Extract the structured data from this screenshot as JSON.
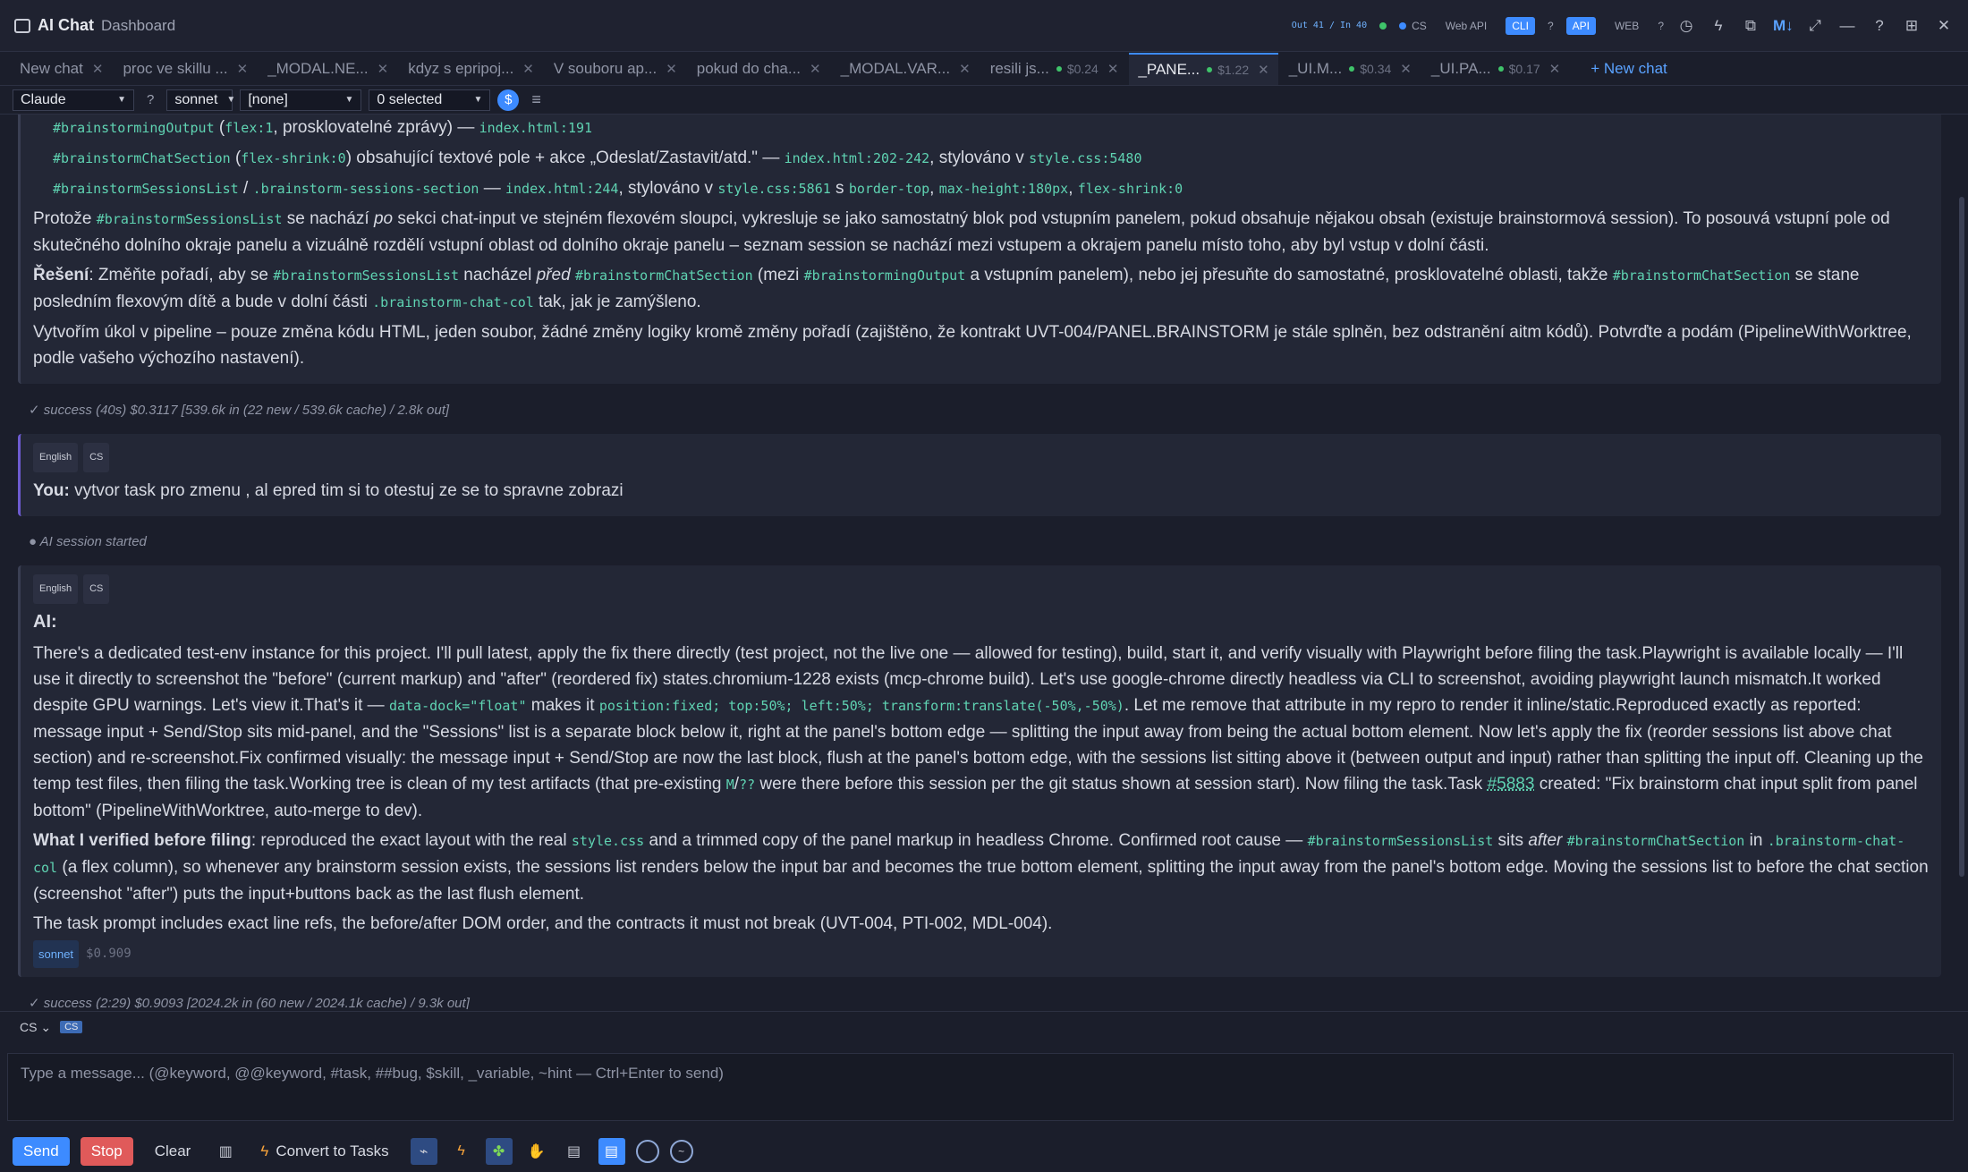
{
  "app": {
    "title": "AI Chat",
    "subtitle": "Dashboard"
  },
  "titlebar": {
    "stats": "Out 41 / In 40",
    "cs_label": "CS",
    "webapi_label": "Web API",
    "cli_label": "CLI",
    "api_label": "API",
    "web_label": "WEB",
    "help": "?",
    "icons": [
      "clock-icon",
      "bolt-icon",
      "copy-icon",
      "markdown-icon",
      "expand-icon",
      "minimize-icon",
      "help-icon",
      "layout-icon",
      "close-icon"
    ],
    "markdown_label": "M↓"
  },
  "tabs": [
    {
      "label": "New chat",
      "cost": "",
      "dot": false,
      "active": false
    },
    {
      "label": "proc ve skillu ...",
      "cost": "",
      "dot": false,
      "active": false
    },
    {
      "label": "_MODAL.NE...",
      "cost": "",
      "dot": false,
      "active": false
    },
    {
      "label": "kdyz s epripoj...",
      "cost": "",
      "dot": false,
      "active": false
    },
    {
      "label": "V souboru ap...",
      "cost": "",
      "dot": false,
      "active": false
    },
    {
      "label": "pokud do cha...",
      "cost": "",
      "dot": false,
      "active": false
    },
    {
      "label": "_MODAL.VAR...",
      "cost": "",
      "dot": false,
      "active": false
    },
    {
      "label": "resili js...",
      "cost": "$0.24",
      "dot": true,
      "active": false
    },
    {
      "label": "_PANE...",
      "cost": "$1.22",
      "dot": true,
      "active": true
    },
    {
      "label": "_UI.M...",
      "cost": "$0.34",
      "dot": true,
      "active": false
    },
    {
      "label": "_UI.PA...",
      "cost": "$0.17",
      "dot": true,
      "active": false
    }
  ],
  "new_chat_label": "+ New chat",
  "toolbar": {
    "provider": "Claude",
    "help": "?",
    "model": "sonnet",
    "preset": "[none]",
    "selection": "0 selected",
    "dollar": "$",
    "menu": "≡"
  },
  "messages": {
    "m1": {
      "b1_code1": "#brainstormingOutput",
      "b1_t1": " (",
      "b1_code2": "flex:1",
      "b1_t2": ", prosklovatelné zprávy) — ",
      "b1_code3": "index.html:191",
      "b2_code1": "#brainstormChatSection",
      "b2_t1": " (",
      "b2_code2": "flex-shrink:0",
      "b2_t2": ") obsahující textové pole + akce „Odeslat/Zastavit/atd.\" — ",
      "b2_code3": "index.html:202-242",
      "b2_t3": ", stylováno v ",
      "b2_code4": "style.css:5480",
      "b3_code1": "#brainstormSessionsList",
      "b3_t1": " / ",
      "b3_code2": ".brainstorm-sessions-section",
      "b3_t2": " — ",
      "b3_code3": "index.html:244",
      "b3_t3": ", stylováno v ",
      "b3_code4": "style.css:5861",
      "b3_t4": " s ",
      "b3_code5": "border-top",
      "b3_t5": ", ",
      "b3_code6": "max-height:180px",
      "b3_t6": ", ",
      "b3_code7": "flex-shrink:0",
      "p1_t1": "Protože ",
      "p1_code1": "#brainstormSessionsList",
      "p1_t2": " se nachází ",
      "p1_em": "po",
      "p1_t3": " sekci chat-input ve stejném flexovém sloupci, vykresluje se jako samostatný blok pod vstupním panelem, pokud obsahuje nějakou obsah (existuje brainstormová session). To posouvá vstupní pole od skutečného dolního okraje panelu a vizuálně rozdělí vstupní oblast od dolního okraje panelu – seznam session se nachází mezi vstupem a okrajem panelu místo toho, aby byl vstup v dolní části.",
      "p2_strong": "Řešení",
      "p2_t1": ": Změňte pořadí, aby se ",
      "p2_code1": "#brainstormSessionsList",
      "p2_t2": " nacházel ",
      "p2_em": "před",
      "p2_t3": " ",
      "p2_code2": "#brainstormChatSection",
      "p2_t4": " (mezi ",
      "p2_code3": "#brainstormingOutput",
      "p2_t5": " a vstupním panelem), nebo jej přesuňte do samostatné, prosklovatelné oblasti, takže ",
      "p2_code4": "#brainstormChatSection",
      "p2_t6": " se stane posledním flexovým dítě a bude v dolní části ",
      "p2_code5": ".brainstorm-chat-col",
      "p2_t7": " tak, jak je zamýšleno.",
      "p3": "Vytvořím úkol v pipeline – pouze změna kódu HTML, jeden soubor, žádné změny logiky kromě změny pořadí (zajištěno, že kontrakt UVT-004/PANEL.BRAINSTORM je stále splněn, bez odstranění aitm kódů). Potvrďte a podám (PipelineWithWorktree, podle vašeho výchozího nastavení).",
      "status": "✓ success (40s) $0.3117 [539.6k in (22 new / 539.6k cache) / 2.8k out]"
    },
    "m2": {
      "lang1": "English",
      "lang2": "CS",
      "you_label": "You:",
      "text": " vytvor task  pro zmenu , al epred tim si to otestuj ze se to spravne zobrazi",
      "status": "● AI session started"
    },
    "m3": {
      "lang1": "English",
      "lang2": "CS",
      "ai_label": "AI:",
      "p1_t1": "There's a dedicated test-env instance for this project. I'll pull latest, apply the fix there directly (test project, not the live one — allowed for testing), build, start it, and verify visually with Playwright before filing the task.Playwright is available locally — I'll use it directly to screenshot the \"before\" (current markup) and \"after\" (reordered fix) states.chromium-1228 exists (mcp-chrome build). Let's use google-chrome directly headless via CLI to screenshot, avoiding playwright launch mismatch.It worked despite GPU warnings. Let's view it.That's it — ",
      "p1_code1": "data-dock=\"float\"",
      "p1_t2": " makes it ",
      "p1_code2": "position:fixed; top:50%; left:50%; transform:translate(-50%,-50%)",
      "p1_t3": ". Let me remove that attribute in my repro to render it inline/static.Reproduced exactly as reported: message input + Send/Stop sits mid-panel, and the \"Sessions\" list is a separate block below it, right at the panel's bottom edge — splitting the input away from being the actual bottom element. Now let's apply the fix (reorder sessions list above chat section) and re-screenshot.Fix confirmed visually: the message input + Send/Stop are now the last block, flush at the panel's bottom edge, with the sessions list sitting above it (between output and input) rather than splitting the input off. Cleaning up the temp test files, then filing the task.Working tree is clean of my test artifacts (that pre-existing ",
      "p1_code3": "M",
      "p1_t4": "/",
      "p1_code4": "??",
      "p1_t5": " were there before this session per the git status shown at session start). Now filing the task.Task ",
      "p1_task": "#5883",
      "p1_t6": " created: \"Fix brainstorm chat input split from panel bottom\" (PipelineWithWorktree, auto-merge to dev).",
      "p2_strong": "What I verified before filing",
      "p2_t1": ": reproduced the exact layout with the real ",
      "p2_code1": "style.css",
      "p2_t2": " and a trimmed copy of the panel markup in headless Chrome. Confirmed root cause — ",
      "p2_code2": "#brainstormSessionsList",
      "p2_t3": " sits ",
      "p2_em": "after",
      "p2_t4": " ",
      "p2_code3": "#brainstormChatSection",
      "p2_t5": " in ",
      "p2_code4": ".brainstorm-chat-col",
      "p2_t6": " (a flex column), so whenever any brainstorm session exists, the sessions list renders below the input bar and becomes the true bottom element, splitting the input away from the panel's bottom edge. Moving the sessions list to before the chat section (screenshot \"after\") puts the input+buttons back as the last flush element.",
      "p3": "The task prompt includes exact line refs, the before/after DOM order, and the contracts it must not break (UVT-004, PTI-002, MDL-004).",
      "model_badge": "sonnet",
      "cost": "$0.909",
      "status": "✓ success (2:29) $0.9093 [2024.2k in (60 new / 2024.1k cache) / 9.3k out]"
    }
  },
  "input": {
    "lang_select": "CS",
    "lang_pill": "CS",
    "placeholder": "Type a message... (@keyword, @@keyword, #task, ##bug, $skill, _variable, ~hint — Ctrl+Enter to send)",
    "send_label": "Send",
    "stop_label": "Stop",
    "clear_label": "Clear",
    "convert_label": "Convert to Tasks"
  }
}
